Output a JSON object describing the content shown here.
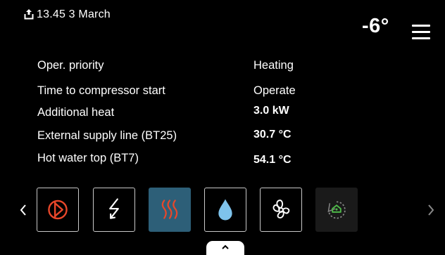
{
  "header": {
    "datetime": "13.45 3 March",
    "outdoor_temperature": "-6°",
    "status_icon": "upload-icon",
    "menu_icon": "hamburger-menu-icon"
  },
  "info_rows": [
    {
      "label": "Oper. priority",
      "value": "Heating"
    },
    {
      "label": "Time to compressor start",
      "value": "Operate"
    },
    {
      "label": "Additional heat",
      "value": "3.0 kW"
    },
    {
      "label": "External supply line (BT25)",
      "value": "30.7 °C"
    },
    {
      "label": "Hot water top (BT7)",
      "value": "54.1 °C"
    }
  ],
  "carousel": {
    "left_arrow": "chevron-left-icon",
    "right_arrow": "chevron-right-icon",
    "tiles": [
      {
        "icon": "compressor-icon",
        "color": "#e8472a"
      },
      {
        "icon": "electric-heater-icon",
        "color": "#ffffff"
      },
      {
        "icon": "heating-icon",
        "color": "#e8472a",
        "active": true
      },
      {
        "icon": "hot-water-drop-icon",
        "color": "#7ec3ec"
      },
      {
        "icon": "ventilation-fan-icon",
        "color": "#ffffff"
      },
      {
        "icon": "smart-home-icon",
        "color": "#4db848"
      }
    ]
  },
  "bottom_tab_icon": "chevron-up-icon",
  "colors": {
    "background": "#000000",
    "active_tile": "#2d5f78",
    "accent_red": "#e8472a",
    "accent_blue": "#7ec3ec",
    "accent_green": "#4db848"
  }
}
